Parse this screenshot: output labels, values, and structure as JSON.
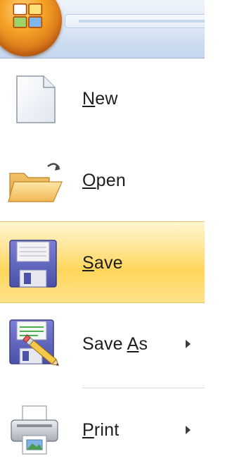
{
  "office_button": {
    "icon": "office-logo-icon"
  },
  "menu": {
    "items": [
      {
        "key": "new",
        "mnemonic": "N",
        "rest": "ew",
        "icon": "new-document-icon",
        "has_submenu": false,
        "selected": false
      },
      {
        "key": "open",
        "mnemonic": "O",
        "rest": "pen",
        "icon": "open-folder-icon",
        "has_submenu": false,
        "selected": false
      },
      {
        "key": "save",
        "mnemonic": "S",
        "rest": "ave",
        "icon": "save-disk-icon",
        "has_submenu": false,
        "selected": true
      },
      {
        "key": "save_as",
        "prefix": "Save ",
        "mnemonic": "A",
        "rest": "s",
        "icon": "save-as-icon",
        "has_submenu": true,
        "selected": false
      },
      {
        "key": "print",
        "mnemonic": "P",
        "rest": "rint",
        "icon": "printer-icon",
        "has_submenu": true,
        "selected": false
      }
    ]
  },
  "colors": {
    "selected_highlight": "#ffd65a",
    "menu_background": "#ffffff",
    "title_bar": "#cddcf0",
    "office_orb": "#f6a327"
  }
}
